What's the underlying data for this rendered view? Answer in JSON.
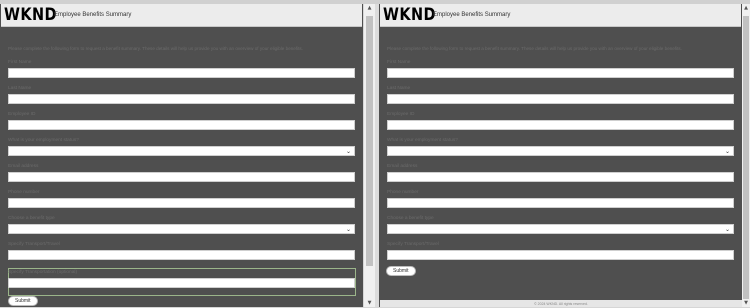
{
  "left_frame": {
    "logo": "WKND",
    "title": "Employee Benefits Summary",
    "intro": "Please complete the following form to request a benefit summary. These details will help us provide you with an overview of your eligible benefits.",
    "labels": [
      "First Name",
      "Last Name",
      "Employee ID",
      "What is your employment status?",
      "Email address",
      "Phone number",
      "Choose a benefit type",
      "Specify Transport/Travel",
      "Specify Transportation (optional)"
    ],
    "submit": "Submit"
  },
  "right_frame": {
    "logo": "WKND",
    "title": "Employee Benefits Summary",
    "intro": "Please complete the following form to request a benefit summary. These details will help us provide you with an overview of your eligible benefits.",
    "labels": [
      "First Name",
      "Last Name",
      "Employee ID",
      "What is your employment status?",
      "Email address",
      "Phone number",
      "Choose a benefit type",
      "Specify Transport/Travel"
    ],
    "submit": "Submit",
    "footer": "© 2024 WKND. All rights reserved."
  },
  "icons": {
    "chevron": "chevron-down-icon",
    "scroll_up": "arrow-up-icon",
    "scroll_down": "arrow-down-icon"
  }
}
